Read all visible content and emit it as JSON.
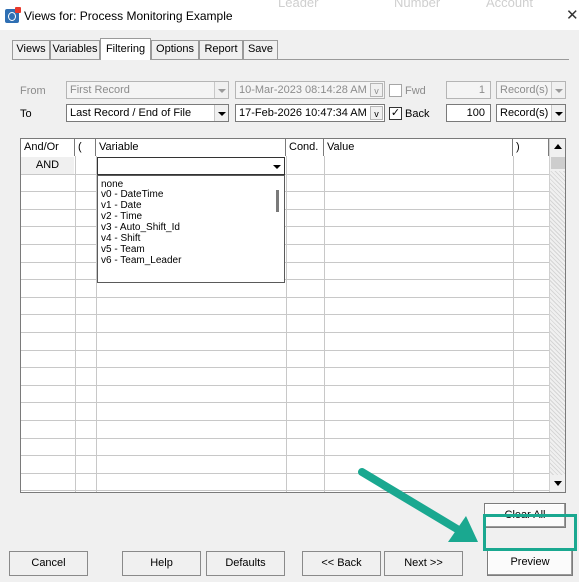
{
  "window": {
    "title": "Views for: Process Monitoring Example",
    "close_glyph": "✕",
    "ghost_texts": [
      "Leader",
      "Number",
      "Account"
    ]
  },
  "tabs": [
    "Views",
    "Variables",
    "Filtering",
    "Options",
    "Report",
    "Save"
  ],
  "active_tab": "Filtering",
  "from_row": {
    "label": "From",
    "record": "First Record",
    "datetime": "10-Mar-2023  08:14:28 AM",
    "v_label": "v",
    "direction_label": "Fwd",
    "direction_checked": false,
    "count": "1",
    "unit": "Record(s)"
  },
  "to_row": {
    "label": "To",
    "record": "Last Record / End of File",
    "datetime": "17-Feb-2026  10:47:34 AM",
    "v_label": "v",
    "direction_label": "Back",
    "direction_checked": true,
    "check_glyph": "✓",
    "count": "100",
    "unit": "Record(s)"
  },
  "grid": {
    "headers": [
      "And/Or",
      "(",
      "Variable",
      "Cond.",
      "Value",
      ")"
    ],
    "first_row_andor": "AND",
    "variable_options": [
      "none",
      "v0 - DateTime",
      "v1 - Date",
      "v2 - Time",
      "v3 - Auto_Shift_Id",
      "v4 - Shift",
      "v5 - Team",
      "v6 - Team_Leader"
    ]
  },
  "buttons": {
    "clear_all": "Clear All",
    "cancel": "Cancel",
    "help": "Help",
    "defaults": "Defaults",
    "back": "<< Back",
    "next": "Next >>",
    "preview": "Preview"
  },
  "colors": {
    "highlight": "#1aa890",
    "arrow": "#1aa890"
  }
}
